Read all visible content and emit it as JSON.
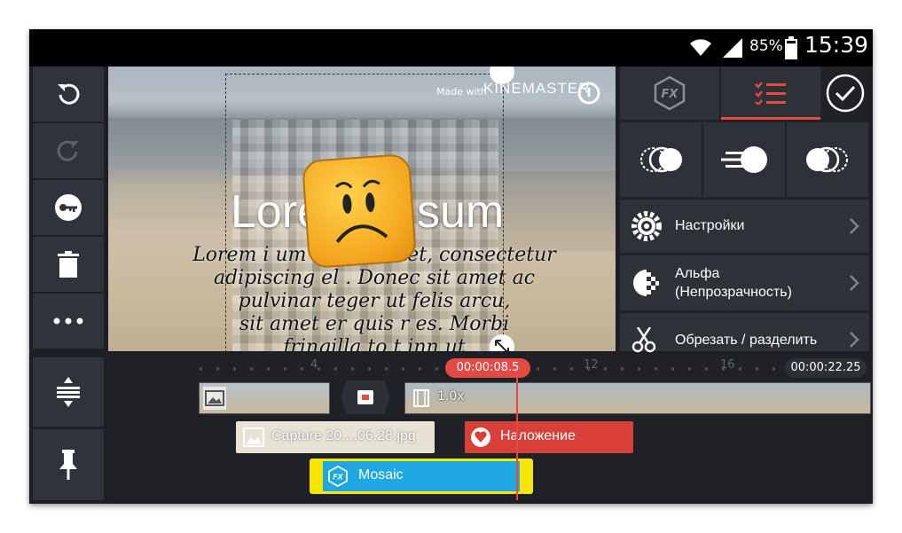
{
  "status_bar": {
    "battery_percent": "85%",
    "time": "15:39"
  },
  "preview": {
    "watermark_prefix": "Made with",
    "watermark_brand": "KINEMASTER",
    "title_part1": "Lore",
    "title_part2": "sum",
    "body_lines": [
      "Lorem i     um d     r sit amet, consectetur",
      "adipiscing el   . Donec sit amet ac",
      "pulvinar        teger ut felis arcu,",
      "sit amet      er quis r   es. Morbi",
      "fringilla to    t  inn    ut"
    ]
  },
  "right_panel": {
    "tabs": [
      "FX",
      "list"
    ],
    "rows": [
      {
        "label": "Настройки",
        "icon": "gear-icon"
      },
      {
        "label": "Альфа\n(Непрозрачность)",
        "icon": "alpha-icon"
      },
      {
        "label": "Обрезать / разделить",
        "icon": "scissors-icon"
      }
    ]
  },
  "timeline": {
    "ticks": [
      "4",
      "12",
      "16"
    ],
    "playhead_time": "00:00:08.5",
    "end_time": "00:00:22.25",
    "clip_speed": "1.0x",
    "layers": {
      "image": "Capture 20....06.28.jpg",
      "overlay": "Наложение",
      "effect": "Mosaic"
    }
  },
  "colors": {
    "accent_red": "#e24a43",
    "effect_blue": "#1ea7e1",
    "effect_yellow": "#f6e600",
    "button_bg": "#2f333b"
  }
}
